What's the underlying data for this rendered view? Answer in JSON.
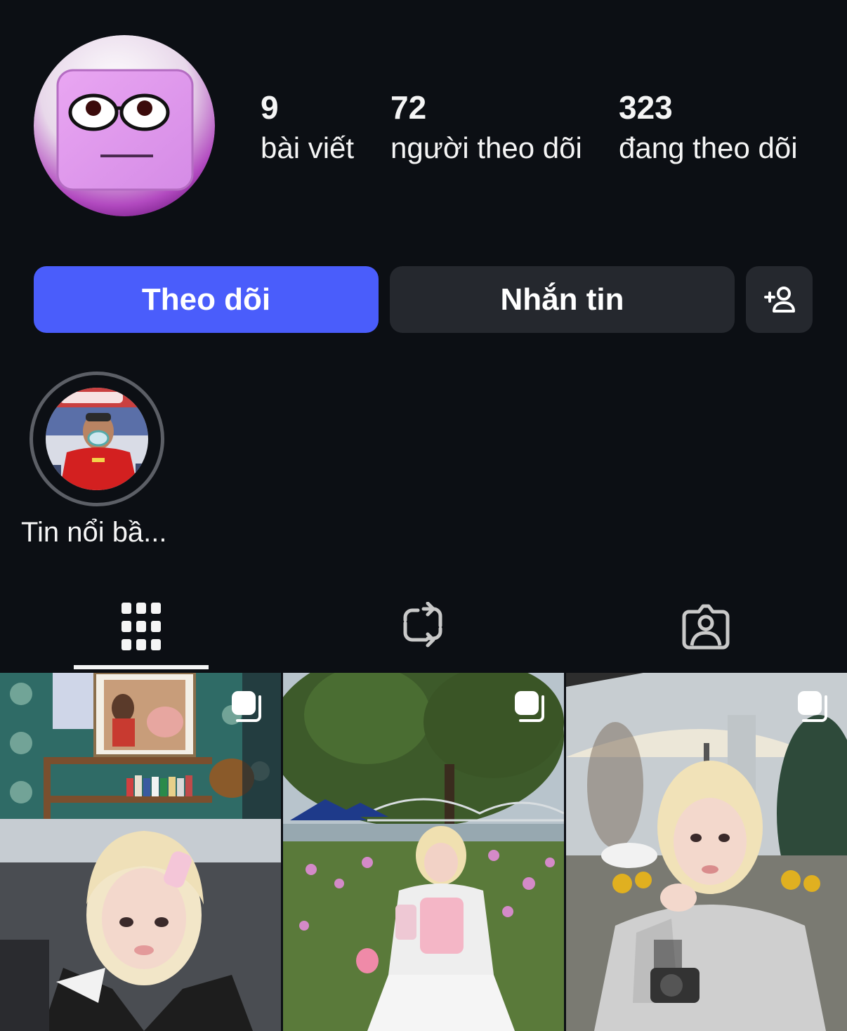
{
  "profile": {
    "stats": {
      "posts_count": "9",
      "posts_label": "bài viết",
      "followers_count": "72",
      "followers_label": "người theo dõi",
      "following_count": "323",
      "following_label": "đang theo dõi"
    }
  },
  "actions": {
    "follow_label": "Theo dõi",
    "message_label": "Nhắn tin",
    "add_user_icon": "add-user-icon"
  },
  "highlights": [
    {
      "label": "Tin nổi bầ..."
    }
  ],
  "tabs": [
    {
      "name": "posts",
      "icon": "grid-icon",
      "active": true
    },
    {
      "name": "reposts",
      "icon": "repost-icon",
      "active": false
    },
    {
      "name": "tagged",
      "icon": "tagged-icon",
      "active": false
    }
  ],
  "colors": {
    "background": "#0c0f14",
    "follow_button": "#4a5dfb",
    "secondary_button": "#25282e",
    "text": "#f5f5f5"
  }
}
